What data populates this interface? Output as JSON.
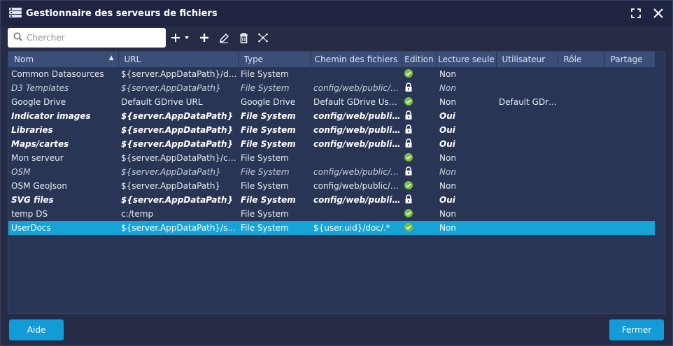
{
  "window": {
    "title": "Gestionnaire des serveurs de fichiers"
  },
  "search": {
    "placeholder": "Chercher",
    "value": ""
  },
  "toolbar": {
    "icons": [
      "add-dropdown-icon",
      "add-icon",
      "edit-icon",
      "delete-icon",
      "network-icon"
    ]
  },
  "table": {
    "columns": [
      "Nom",
      "URL",
      "Type",
      "Chemin des fichiers",
      "Edition",
      "Lecture seule",
      "Utilisateur",
      "Rôle",
      "Partage"
    ],
    "sort": {
      "column": "Nom",
      "direction": "asc"
    },
    "rows": [
      {
        "name": "Common Datasources",
        "url": "${server.AppDataPath}/data...",
        "type": "File System",
        "path": "",
        "edition": "check",
        "readonly": "Non",
        "user": "",
        "role": "",
        "share": "",
        "style": "normal"
      },
      {
        "name": "D3 Templates",
        "url": "${server.AppDataPath}",
        "type": "File System",
        "path": "config/web/public/D...",
        "edition": "lock",
        "readonly": "Non",
        "user": "",
        "role": "",
        "share": "",
        "style": "italic"
      },
      {
        "name": "Google Drive",
        "url": "Default GDrive URL",
        "type": "Google Drive",
        "path": "Default GDrive User ...",
        "edition": "check",
        "readonly": "Non",
        "user": "Default GDri...",
        "role": "",
        "share": "",
        "style": "normal"
      },
      {
        "name": "Indicator images",
        "url": "${server.AppDataPath}",
        "type": "File System",
        "path": "config/web/public/in...",
        "edition": "lock",
        "readonly": "Oui",
        "user": "",
        "role": "",
        "share": "",
        "style": "bold"
      },
      {
        "name": "Libraries",
        "url": "${server.AppDataPath}",
        "type": "File System",
        "path": "config/web/public/li...",
        "edition": "lock",
        "readonly": "Oui",
        "user": "",
        "role": "",
        "share": "",
        "style": "bold"
      },
      {
        "name": "Maps/cartes",
        "url": "${server.AppDataPath}",
        "type": "File System",
        "path": "config/web/public/m...",
        "edition": "lock",
        "readonly": "Oui",
        "user": "",
        "role": "",
        "share": "",
        "style": "bold"
      },
      {
        "name": "Mon serveur",
        "url": "${server.AppDataPath}/con...",
        "type": "File System",
        "path": "",
        "edition": "check",
        "readonly": "Non",
        "user": "",
        "role": "",
        "share": "",
        "style": "normal"
      },
      {
        "name": "OSM",
        "url": "${server.AppDataPath}",
        "type": "File System",
        "path": "config/web/public/o...",
        "edition": "lock",
        "readonly": "Non",
        "user": "",
        "role": "",
        "share": "",
        "style": "italic"
      },
      {
        "name": "OSM GeoJson",
        "url": "${server.AppDataPath}",
        "type": "File System",
        "path": "config/web/public/m...",
        "edition": "check",
        "readonly": "Non",
        "user": "",
        "role": "",
        "share": "",
        "style": "normal"
      },
      {
        "name": "SVG files",
        "url": "${server.AppDataPath}",
        "type": "File System",
        "path": "config/web/public/v...",
        "edition": "lock",
        "readonly": "Oui",
        "user": "",
        "role": "",
        "share": "",
        "style": "bold"
      },
      {
        "name": "temp DS",
        "url": "c:/temp",
        "type": "File System",
        "path": "",
        "edition": "check",
        "readonly": "Non",
        "user": "",
        "role": "",
        "share": "",
        "style": "normal"
      },
      {
        "name": "UserDocs",
        "url": "${server.AppDataPath}/server",
        "type": "File System",
        "path": "${user.uid}/doc/.*",
        "edition": "check",
        "readonly": "Non",
        "user": "",
        "role": "",
        "share": "",
        "style": "selected"
      }
    ]
  },
  "footer": {
    "help_label": "Aide",
    "close_label": "Fermer"
  },
  "colors": {
    "accent": "#16a3d6",
    "check": "#7bc043",
    "header": "#3b4e78",
    "background": "#262c46"
  }
}
